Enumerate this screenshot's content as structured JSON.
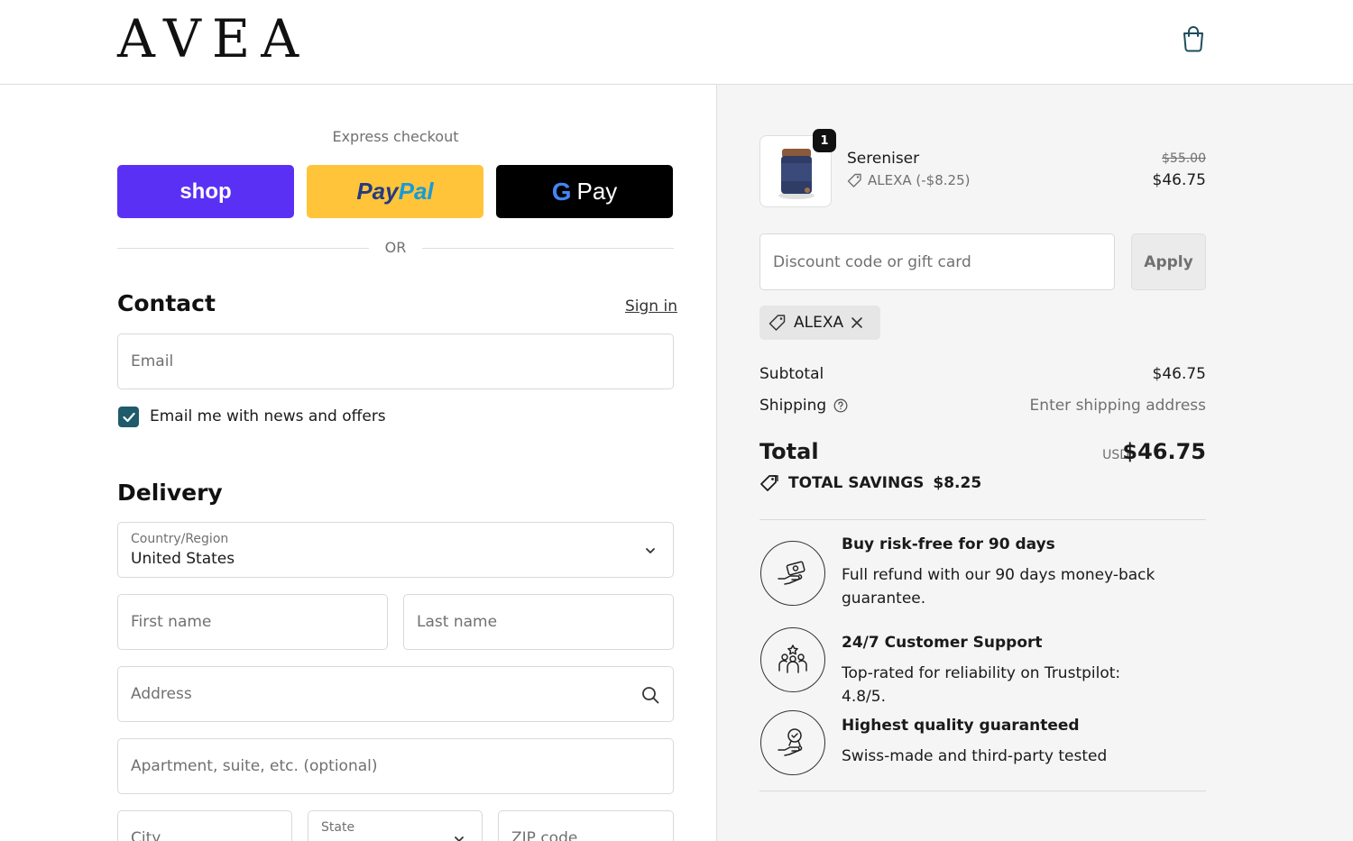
{
  "header": {
    "brand": "AVEA"
  },
  "express": {
    "title": "Express checkout",
    "shop_label": "shop",
    "paypal_part1": "Pay",
    "paypal_part2": "Pal",
    "gpay_g": "G",
    "gpay_label": "Pay",
    "or": "OR"
  },
  "contact": {
    "title": "Contact",
    "signin": "Sign in",
    "email_placeholder": "Email",
    "newsletter_label": "Email me with news and offers",
    "newsletter_checked": true
  },
  "delivery": {
    "title": "Delivery",
    "country_label": "Country/Region",
    "country_value": "United States",
    "first_name_placeholder": "First name",
    "last_name_placeholder": "Last name",
    "address_placeholder": "Address",
    "apartment_placeholder": "Apartment, suite, etc. (optional)",
    "city_placeholder": "City",
    "state_label": "State",
    "zip_placeholder": "ZIP code"
  },
  "order": {
    "item": {
      "name": "Sereniser",
      "quantity": "1",
      "discount": "ALEXA (-$8.25)",
      "price_original": "$55.00",
      "price_final": "$46.75"
    },
    "discount_placeholder": "Discount code or gift card",
    "apply_label": "Apply",
    "applied_code": "ALEXA",
    "subtotal_label": "Subtotal",
    "subtotal_value": "$46.75",
    "shipping_label": "Shipping",
    "shipping_value": "Enter shipping address",
    "total_label": "Total",
    "total_currency": "USD",
    "total_value": "$46.75",
    "savings_label": "TOTAL SAVINGS",
    "savings_value": "$8.25"
  },
  "perks": [
    {
      "title": "Buy risk-free for 90 days",
      "text": "Full refund with our 90 days money-back guarantee.",
      "icon": "money-hand-icon"
    },
    {
      "title": "24/7 Customer Support",
      "text": "Top-rated for reliability on Trustpilot: 4.8/5.",
      "icon": "support-team-icon"
    },
    {
      "title": "Highest quality guaranteed",
      "text": "Swiss-made and third-party tested",
      "icon": "quality-badge-hand-icon"
    }
  ],
  "colors": {
    "shop": "#5a31f4",
    "paypal": "#ffc439",
    "gpay": "#000000",
    "checkbox": "#1f5b6a",
    "summary_bg": "#f5f5f5"
  }
}
